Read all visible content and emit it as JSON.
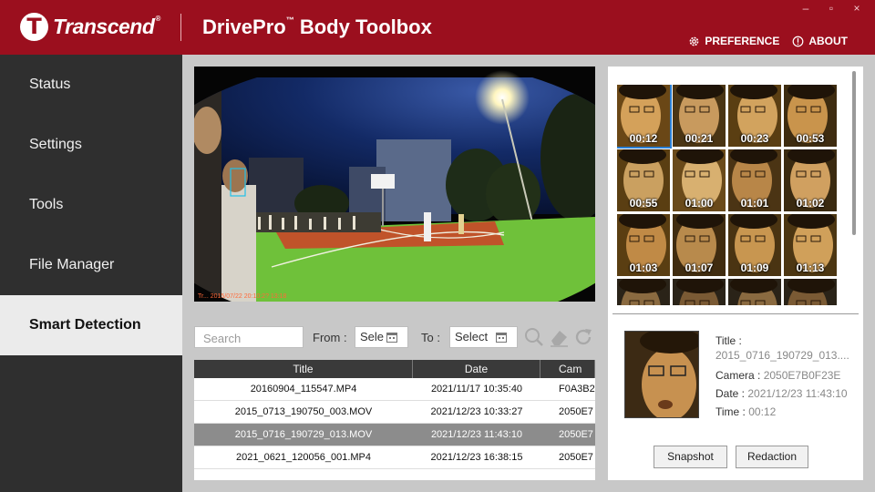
{
  "header": {
    "brand": "Transcend",
    "brand_reg": "®",
    "app_title": "DrivePro",
    "app_title_tm": "™",
    "app_title_rest": " Body Toolbox",
    "preference_label": "PREFERENCE",
    "about_label": "ABOUT",
    "window_controls": [
      "‒",
      "▫",
      "×"
    ]
  },
  "sidebar": {
    "items": [
      {
        "label": "Status"
      },
      {
        "label": "Settings"
      },
      {
        "label": "Tools"
      },
      {
        "label": "File Manager"
      },
      {
        "label": "Smart Detection",
        "active": true
      }
    ]
  },
  "video": {
    "watermark": "Tr... 2015/07/22 20:10:2? 13:18"
  },
  "filters": {
    "search_placeholder": "Search",
    "from_label": "From :",
    "from_value": "Sele",
    "to_label": "To :",
    "to_value": "Select"
  },
  "table": {
    "headers": [
      "Title",
      "Date",
      "Cam"
    ],
    "rows": [
      {
        "title": "20160904_115547.MP4",
        "date": "2021/11/17 10:35:40",
        "camera": "F0A3B2",
        "selected": false
      },
      {
        "title": "2015_0713_190750_003.MOV",
        "date": "2021/12/23 10:33:27",
        "camera": "2050E7",
        "selected": false
      },
      {
        "title": "2015_0716_190729_013.MOV",
        "date": "2021/12/23 11:43:10",
        "camera": "2050E7",
        "selected": true
      },
      {
        "title": "2021_0621_120056_001.MP4",
        "date": "2021/12/23 16:38:15",
        "camera": "2050E7",
        "selected": false
      }
    ]
  },
  "faces": {
    "thumbnails": [
      {
        "time": "00:12",
        "selected": true
      },
      {
        "time": "00:21"
      },
      {
        "time": "00:23"
      },
      {
        "time": "00:53"
      },
      {
        "time": "00:55"
      },
      {
        "time": "01:00"
      },
      {
        "time": "01:01"
      },
      {
        "time": "01:02"
      },
      {
        "time": "01:03"
      },
      {
        "time": "01:07"
      },
      {
        "time": "01:09"
      },
      {
        "time": "01:13"
      },
      {
        "time": ""
      },
      {
        "time": ""
      },
      {
        "time": ""
      },
      {
        "time": ""
      }
    ]
  },
  "detail": {
    "title_label": "Title :",
    "title_value": "2015_0716_190729_013....",
    "camera_label": "Camera :",
    "camera_value": "2050E7B0F23E",
    "date_label": "Date :",
    "date_value": "2021/12/23 11:43:10",
    "time_label": "Time :",
    "time_value": "00:12"
  },
  "buttons": {
    "snapshot": "Snapshot",
    "redaction": "Redaction"
  },
  "colors": {
    "brand_red": "#9b0f1e",
    "sidebar_dark": "#2f2f2f",
    "selection_blue": "#2a7fd4",
    "court_green": "#6fc13a"
  }
}
